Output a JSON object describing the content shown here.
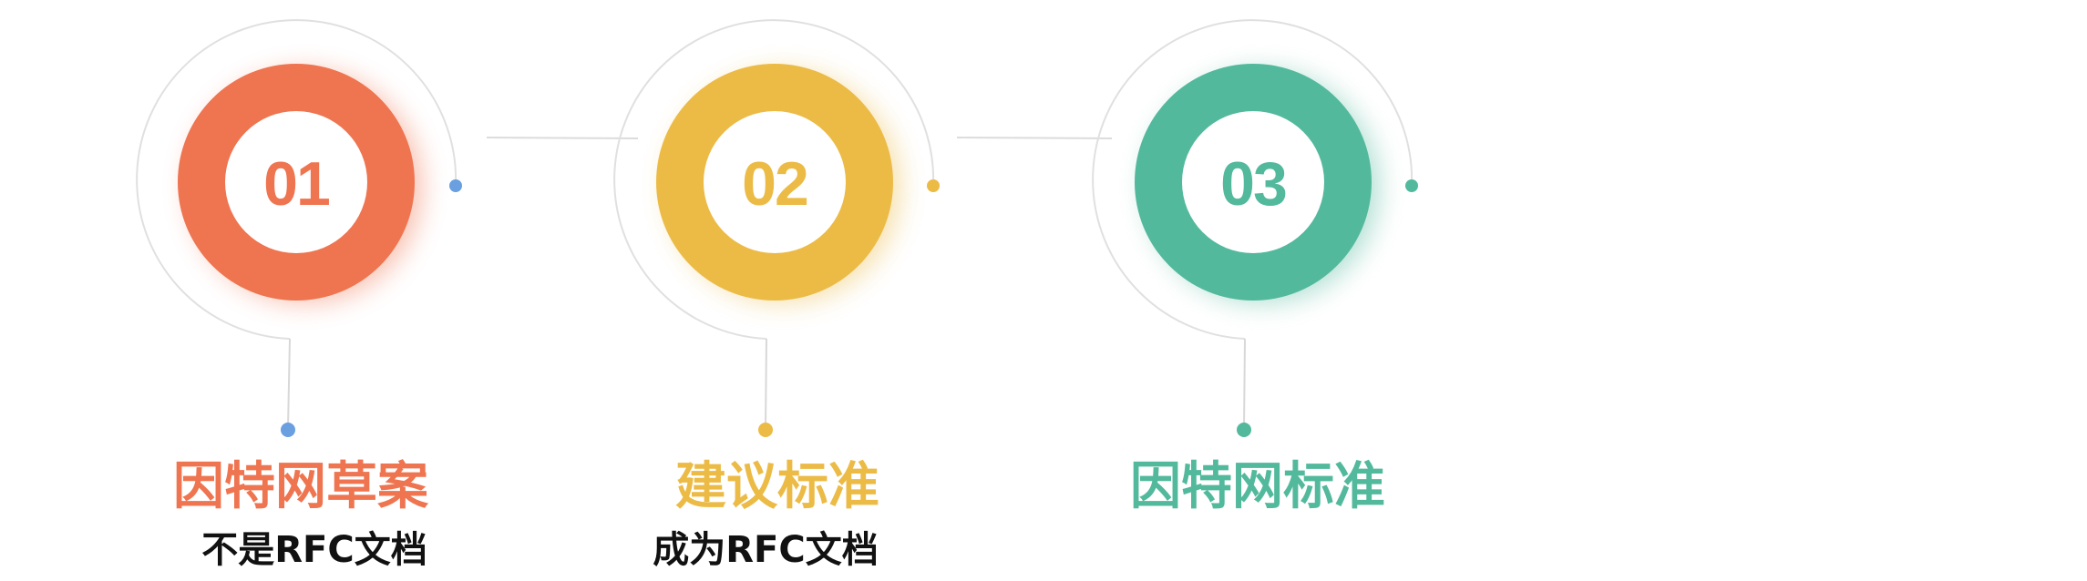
{
  "steps": [
    {
      "number": "01",
      "title": "因特网草案",
      "subtitle": "不是RFC文档",
      "color": "#ef7450",
      "dot_color": "#6a9fe0"
    },
    {
      "number": "02",
      "title": "建议标准",
      "subtitle": "成为RFC文档",
      "color": "#ecbb46",
      "dot_color": "#ecbb46"
    },
    {
      "number": "03",
      "title": "因特网标准",
      "subtitle": "",
      "color": "#53b99c",
      "dot_color": "#53b99c"
    }
  ]
}
